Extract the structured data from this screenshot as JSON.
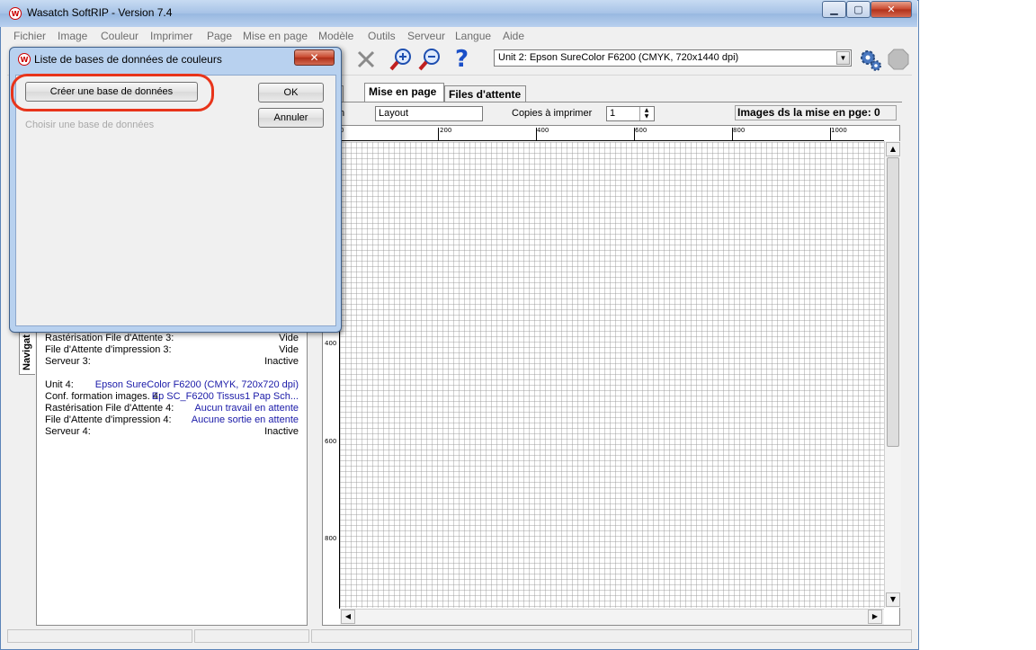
{
  "window": {
    "title": "Wasatch SoftRIP - Version 7.4",
    "minimize_glyph": "▁",
    "maximize_glyph": "▢",
    "close_glyph": "✕"
  },
  "menu": [
    "Fichier",
    "Image",
    "Couleur",
    "Imprimer",
    "Page",
    "Mise en page",
    "Modèle",
    "Outils",
    "Serveur",
    "Langue",
    "Aide"
  ],
  "toolbar": {
    "unit_selected": "Unit 2: Epson  SureColor F6200  (CMYK, 720x1440 dpi)",
    "icons": [
      "delete-x-icon",
      "zoom-in-icon",
      "zoom-out-icon",
      "help-icon",
      "settings-gears-icon",
      "stop-icon"
    ]
  },
  "tabs": {
    "partial": "o",
    "mise_en_page": "Mise en page",
    "files_attente": "Files d'attente"
  },
  "layout": {
    "name_label_partial": "n",
    "name_value": "Layout",
    "copies_label": "Copies à imprimer",
    "copies_value": "1",
    "images_count_label": "Images ds la mise en pge: 0"
  },
  "ruler": {
    "top_labels": [
      "0",
      "200",
      "400",
      "600",
      "800",
      "1000"
    ],
    "left_labels": [
      "400",
      "600",
      "800"
    ]
  },
  "navigator_tab": "Navigat",
  "status_rows": [
    {
      "label": "Rastérisation File d'Attente 3:",
      "value": "Vide",
      "blue": false
    },
    {
      "label": "File d'Attente d'impression 3:",
      "value": "Vide",
      "blue": false
    },
    {
      "label": "Serveur 3:",
      "value": "Inactive",
      "blue": false
    },
    {
      "label": "Unit 4:",
      "value": "Epson  SureColor F6200  (CMYK, 720x720 dpi)",
      "blue": true
    },
    {
      "label": "Conf. formation images. 4:",
      "value": "Ep SC_F6200 Tissus1 Pap Sch...",
      "blue": true
    },
    {
      "label": "Rastérisation File d'Attente 4:",
      "value": "Aucun travail en attente",
      "blue": true
    },
    {
      "label": "File d'Attente d'impression 4:",
      "value": "Aucune sortie en attente",
      "blue": true
    },
    {
      "label": "Serveur 4:",
      "value": "Inactive",
      "blue": false
    }
  ],
  "dialog": {
    "title": "Liste de bases de données de couleurs",
    "create_button": "Créer une base de données",
    "ok_button": "OK",
    "cancel_button": "Annuler",
    "choose_label": "Choisir une base de données",
    "close_glyph": "✕"
  },
  "colors": {
    "highlight": "#e8341a",
    "blue_text": "#1a1aa8"
  }
}
